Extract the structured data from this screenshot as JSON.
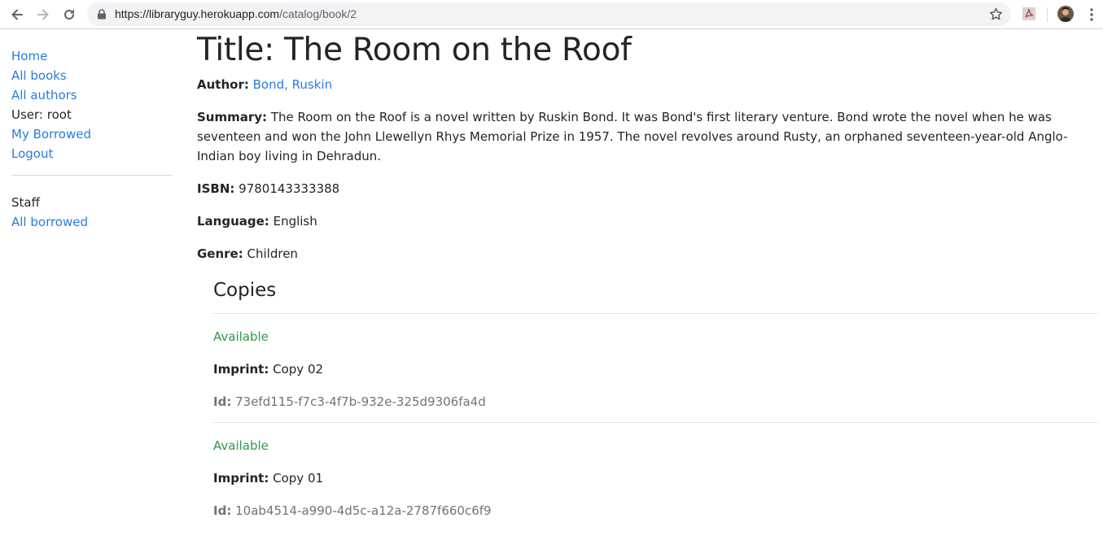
{
  "browser": {
    "url_host": "https://libraryguy.herokuapp.com",
    "url_path": "/catalog/book/2"
  },
  "sidebar": {
    "items": [
      {
        "label": "Home",
        "link": true
      },
      {
        "label": "All books",
        "link": true
      },
      {
        "label": "All authors",
        "link": true
      },
      {
        "label": "User: root",
        "link": false
      },
      {
        "label": "My Borrowed",
        "link": true
      },
      {
        "label": "Logout",
        "link": true
      }
    ],
    "staff_heading": "Staff",
    "staff_items": [
      {
        "label": "All borrowed"
      }
    ]
  },
  "book": {
    "title": "Title: The Room on the Roof",
    "author_label": "Author:",
    "author": "Bond, Ruskin",
    "summary_label": "Summary:",
    "summary": "The Room on the Roof is a novel written by Ruskin Bond. It was Bond's first literary venture. Bond wrote the novel when he was seventeen and won the John Llewellyn Rhys Memorial Prize in 1957. The novel revolves around Rusty, an orphaned seventeen-year-old Anglo-Indian boy living in Dehradun.",
    "isbn_label": "ISBN:",
    "isbn": "9780143333388",
    "language_label": "Language:",
    "language": "English",
    "genre_label": "Genre:",
    "genre": "Children"
  },
  "copies": {
    "heading": "Copies",
    "items": [
      {
        "status": "Available",
        "imprint_label": "Imprint:",
        "imprint": "Copy 02",
        "id_label": "Id:",
        "id": "73efd115-f7c3-4f7b-932e-325d9306fa4d"
      },
      {
        "status": "Available",
        "imprint_label": "Imprint:",
        "imprint": "Copy 01",
        "id_label": "Id:",
        "id": "10ab4514-a990-4d5c-a12a-2787f660c6f9"
      }
    ]
  },
  "colors": {
    "link": "#2a7ae2",
    "available": "#2e9a45",
    "muted": "#6c757d"
  }
}
